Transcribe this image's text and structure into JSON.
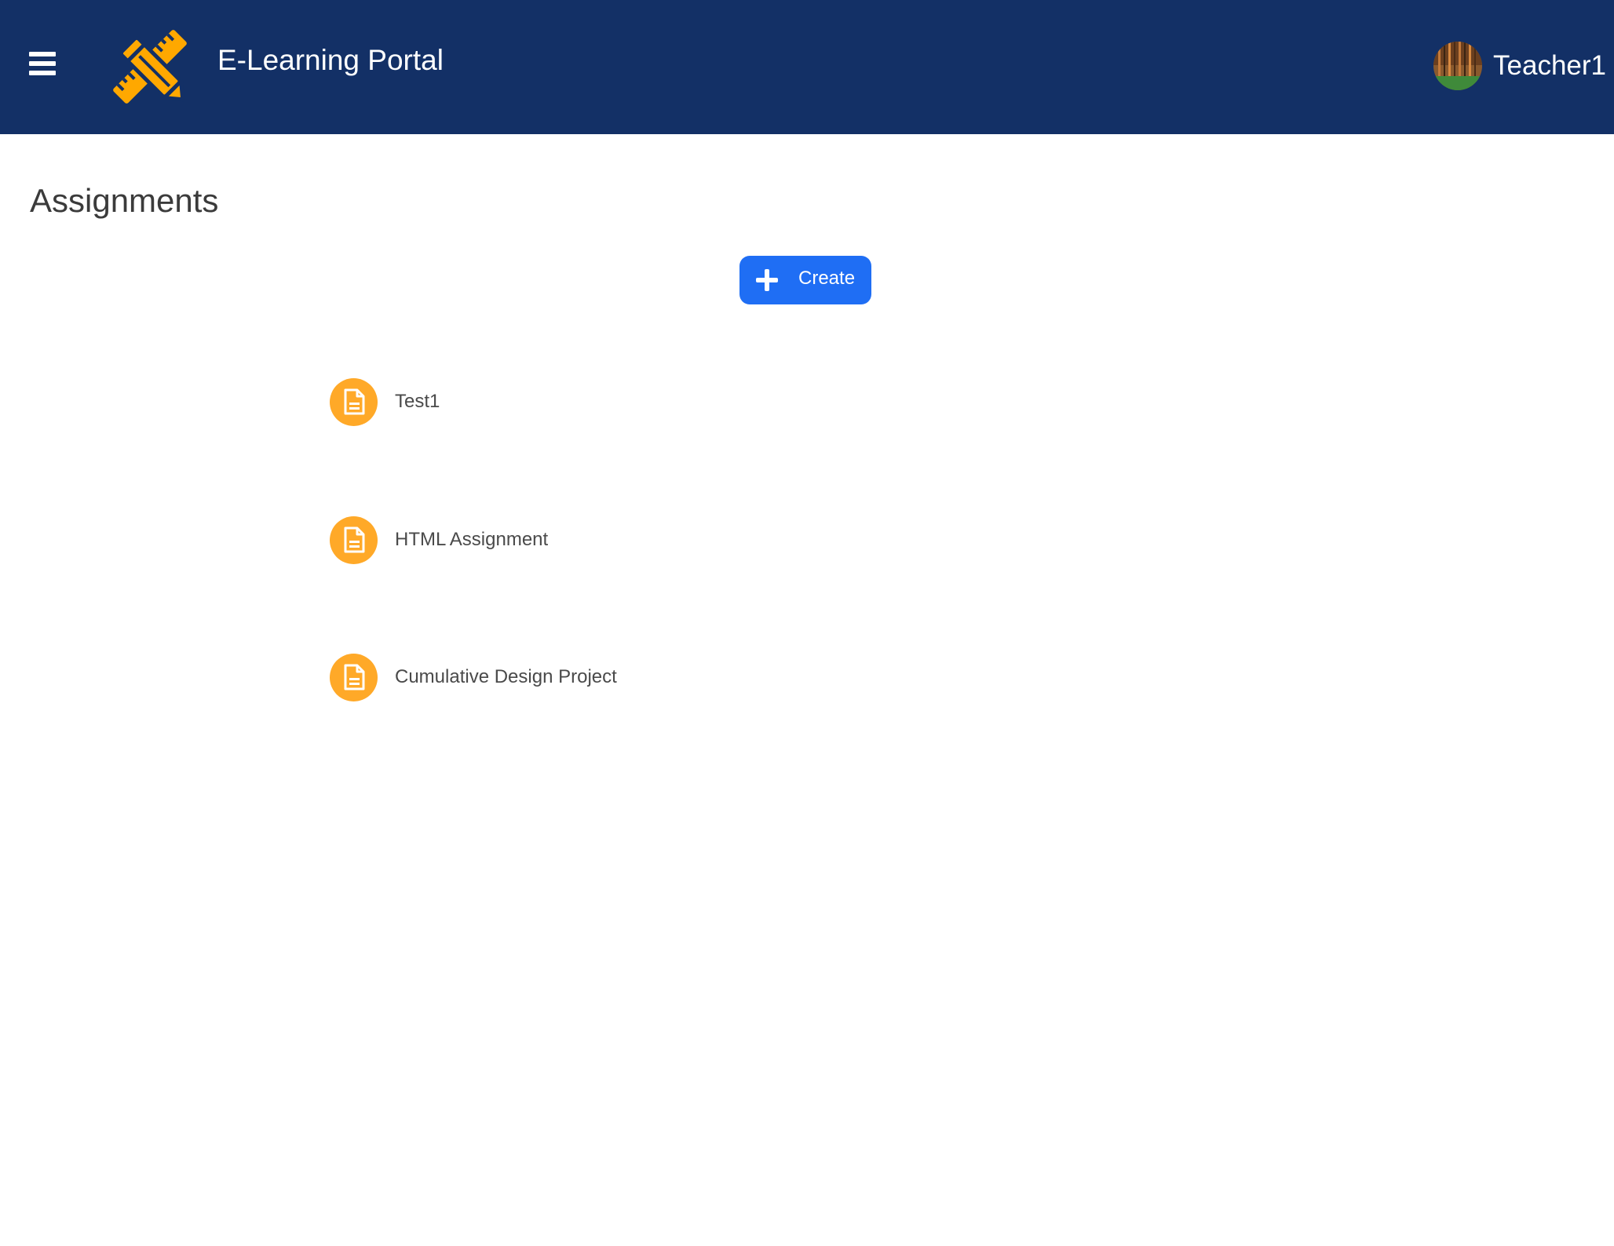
{
  "header": {
    "app_title": "E-Learning Portal",
    "logo_icon": "pencil-ruler-icon",
    "menu_icon": "hamburger-menu-icon",
    "user_name": "Teacher1",
    "background_color": "#133066",
    "logo_color": "#ffa800"
  },
  "main": {
    "title": "Assignments",
    "create_button": {
      "label": "Create",
      "icon": "plus-icon",
      "color": "#1f6ef4"
    },
    "assignments": [
      {
        "name": "Test1",
        "icon": "document-icon"
      },
      {
        "name": "HTML Assignment",
        "icon": "document-icon"
      },
      {
        "name": "Cumulative Design Project",
        "icon": "document-icon"
      }
    ],
    "assignment_icon_color": "#ffa928"
  }
}
